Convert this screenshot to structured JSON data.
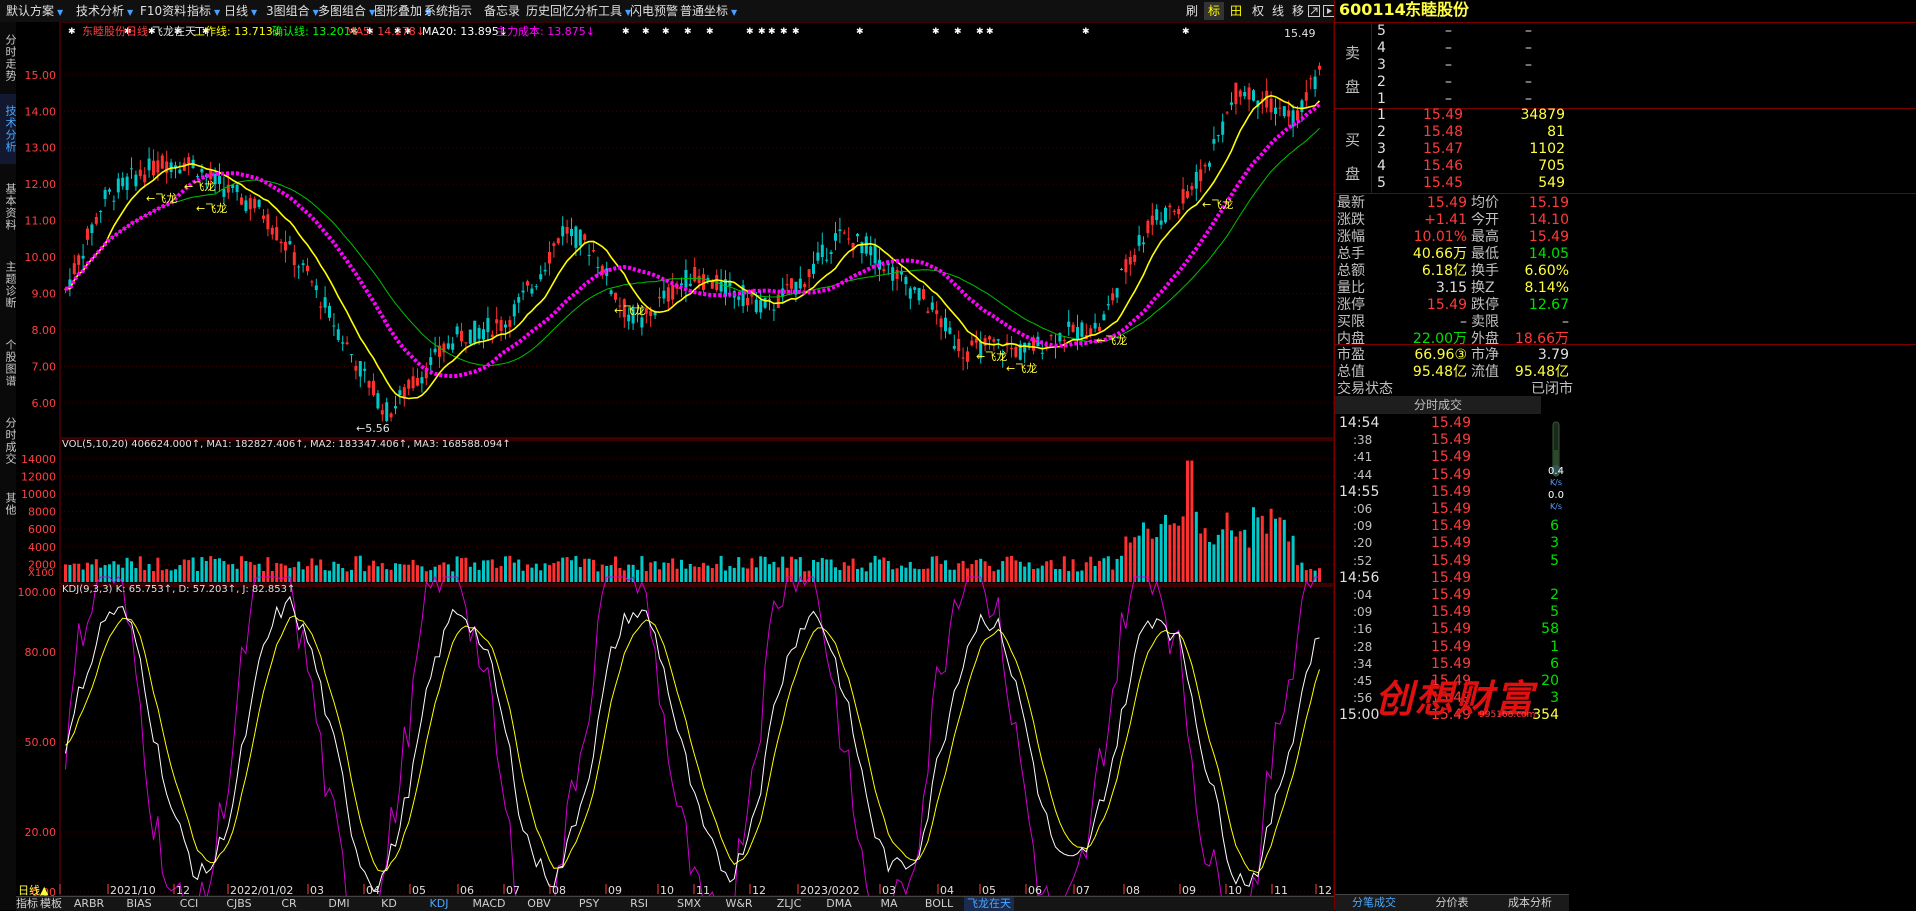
{
  "toolbar": {
    "items": [
      "默认方案",
      "技术分析",
      "F10资料",
      "指标",
      "日线",
      "3图组合",
      "多图组合",
      "图形叠加",
      "系统指示",
      "备忘录",
      "历史回忆",
      "分析工具",
      "闪电预警",
      "普通坐标"
    ],
    "right": [
      "刷",
      "标",
      "田",
      "权",
      "线",
      "移"
    ]
  },
  "left_tabs": [
    "分时走势",
    "技术分析",
    "基本资料",
    "主题诊断",
    "个股图谱",
    "分时成交",
    "其他"
  ],
  "stock": {
    "code": "600114",
    "name": "东睦股份"
  },
  "chart_header": {
    "title": "东睦股份日线",
    "indicator": "飞龙在天",
    "items": [
      {
        "label": "工作线: 13.713↓",
        "color": "#ffff00"
      },
      {
        "label": "确认线: 13.201↓",
        "color": "#00ff00"
      },
      {
        "label": "MA5: 14.278↓",
        "color": "#ff4040"
      },
      {
        "label": "MA20: 13.895↓",
        "color": "#ffffff"
      },
      {
        "label": "主力成本: 13.875↓",
        "color": "#ff00ff"
      }
    ]
  },
  "price_axis": [
    "15.00",
    "14.00",
    "13.00",
    "12.00",
    "11.00",
    "10.00",
    "9.00",
    "8.00",
    "7.00",
    "6.00"
  ],
  "annotations": {
    "high": "15.49",
    "low": "←5.56",
    "signal": "←飞龙"
  },
  "volume": {
    "header": "VOL(5,10,20)  406624.000↑, MA1: 182827.406↑, MA2: 183347.406↑, MA3: 168588.094↑",
    "axis": [
      "14000",
      "12000",
      "10000",
      "8000",
      "6000",
      "4000",
      "2000"
    ],
    "unit": "X100"
  },
  "kdj": {
    "header": "KDJ(9,3,3)  K: 65.753↑, D: 57.203↑, J: 82.853↑",
    "axis": [
      "100.00",
      "80.00",
      "50.00",
      "20.00",
      "0.00"
    ]
  },
  "time_axis": [
    "日线▲",
    "2021/10",
    "12",
    "2022/01/02",
    "03",
    "04",
    "05",
    "06",
    "07",
    "08",
    "09",
    "10",
    "11",
    "12",
    "2023/0202",
    "03",
    "04",
    "05",
    "06",
    "07",
    "08",
    "09",
    "10",
    "11",
    "12"
  ],
  "bottom_tabs": [
    "指标",
    "模板",
    "ARBR",
    "BIAS",
    "CCI",
    "CJBS",
    "CR",
    "DMI",
    "KD",
    "KDJ",
    "MACD",
    "OBV",
    "PSY",
    "RSI",
    "SMX",
    "W&R",
    "ZLJC",
    "DMA",
    "MA",
    "BOLL",
    "飞龙在天"
  ],
  "order_book": {
    "sell_label": "卖盘",
    "buy_label": "买盘",
    "sell": [
      {
        "level": "5",
        "price": "–",
        "vol": "–"
      },
      {
        "level": "4",
        "price": "–",
        "vol": "–"
      },
      {
        "level": "3",
        "price": "–",
        "vol": "–"
      },
      {
        "level": "2",
        "price": "–",
        "vol": "–"
      },
      {
        "level": "1",
        "price": "–",
        "vol": "–"
      }
    ],
    "buy": [
      {
        "level": "1",
        "price": "15.49",
        "vol": "34879"
      },
      {
        "level": "2",
        "price": "15.48",
        "vol": "81"
      },
      {
        "level": "3",
        "price": "15.47",
        "vol": "1102"
      },
      {
        "level": "4",
        "price": "15.46",
        "vol": "705"
      },
      {
        "level": "5",
        "price": "15.45",
        "vol": "549"
      }
    ]
  },
  "quote": [
    {
      "l1": "最新",
      "v1": "15.49",
      "c1": "red",
      "l2": "均价",
      "v2": "15.19",
      "c2": "red"
    },
    {
      "l1": "涨跌",
      "v1": "+1.41",
      "c1": "red",
      "l2": "今开",
      "v2": "14.10",
      "c2": "red"
    },
    {
      "l1": "涨幅",
      "v1": "10.01%",
      "c1": "red",
      "l2": "最高",
      "v2": "15.49",
      "c2": "red"
    },
    {
      "l1": "总手",
      "v1": "40.66万",
      "c1": "yellow",
      "l2": "最低",
      "v2": "14.05",
      "c2": "green"
    },
    {
      "l1": "总额",
      "v1": "6.18亿",
      "c1": "yellow",
      "l2": "换手",
      "v2": "6.60%",
      "c2": "yellow"
    },
    {
      "l1": "量比",
      "v1": "3.15",
      "c1": "white",
      "l2": "换Z",
      "v2": "8.14%",
      "c2": "yellow"
    },
    {
      "l1": "涨停",
      "v1": "15.49",
      "c1": "red",
      "l2": "跌停",
      "v2": "12.67",
      "c2": "green"
    },
    {
      "l1": "买限",
      "v1": "–",
      "c1": "white",
      "l2": "卖限",
      "v2": "–",
      "c2": "white"
    },
    {
      "l1": "内盘",
      "v1": "22.00万",
      "c1": "green",
      "l2": "外盘",
      "v2": "18.66万",
      "c2": "red"
    }
  ],
  "quote2": [
    {
      "l1": "市盈",
      "v1": "66.96③",
      "c1": "yellow",
      "l2": "市净",
      "v2": "3.79",
      "c2": "white"
    },
    {
      "l1": "总值",
      "v1": "95.48亿",
      "c1": "yellow",
      "l2": "流值",
      "v2": "95.48亿",
      "c2": "yellow"
    }
  ],
  "trade_status": {
    "label": "交易状态",
    "value": "已闭市"
  },
  "ticks_title": "分时成交",
  "ticks": [
    {
      "time": "14:54",
      "price": "15.49",
      "vol": "",
      "major": true
    },
    {
      "time": ":38",
      "price": "15.49",
      "vol": "",
      "major": false
    },
    {
      "time": ":41",
      "price": "15.49",
      "vol": "",
      "major": false
    },
    {
      "time": ":44",
      "price": "15.49",
      "vol": "",
      "major": false
    },
    {
      "time": "14:55",
      "price": "15.49",
      "vol": "",
      "major": true
    },
    {
      "time": ":06",
      "price": "15.49",
      "vol": "",
      "major": false
    },
    {
      "time": ":09",
      "price": "15.49",
      "vol": "6",
      "major": false
    },
    {
      "time": ":20",
      "price": "15.49",
      "vol": "3",
      "major": false
    },
    {
      "time": ":52",
      "price": "15.49",
      "vol": "5",
      "major": false
    },
    {
      "time": "14:56",
      "price": "15.49",
      "vol": "",
      "major": true
    },
    {
      "time": ":04",
      "price": "15.49",
      "vol": "2",
      "major": false
    },
    {
      "time": ":09",
      "price": "15.49",
      "vol": "5",
      "major": false
    },
    {
      "time": ":16",
      "price": "15.49",
      "vol": "58",
      "major": false
    },
    {
      "time": ":28",
      "price": "15.49",
      "vol": "1",
      "major": false
    },
    {
      "time": ":34",
      "price": "15.49",
      "vol": "6",
      "major": false
    },
    {
      "time": ":45",
      "price": "15.49",
      "vol": "20",
      "major": false
    },
    {
      "time": ":56",
      "price": "15.49",
      "vol": "3",
      "major": false
    },
    {
      "time": "15:00",
      "price": "15.49",
      "vol": "354",
      "major": true
    }
  ],
  "speed": {
    "up": "0.4",
    "down": "0.0",
    "unit": "K/s"
  },
  "right_tabs": [
    "分笔成交",
    "分价表",
    "成本分析"
  ],
  "watermark": {
    "text": "创想财富",
    "url": "995168.com"
  }
}
